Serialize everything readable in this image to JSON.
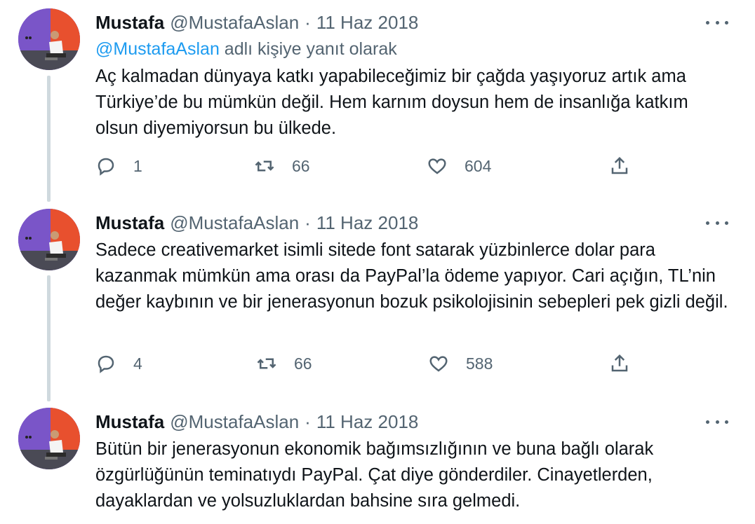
{
  "tweets": [
    {
      "name": "Mustafa",
      "handle": "@MustafaAslan",
      "separator": "·",
      "date": "11 Haz 2018",
      "reply_mention": "@MustafaAslan",
      "reply_suffix": " adlı kişiye yanıt olarak",
      "text": "Aç kalmadan dünyaya katkı yapabileceğimiz bir çağda yaşıyoruz artık ama Türkiye’de bu mümkün değil. Hem karnım doysun hem de insanlığa katkım olsun diyemiyorsun bu ülkede.",
      "replies": "1",
      "retweets": "66",
      "likes": "604"
    },
    {
      "name": "Mustafa",
      "handle": "@MustafaAslan",
      "separator": "·",
      "date": "11 Haz 2018",
      "text": "Sadece creativemarket isimli sitede font satarak yüzbinlerce dolar para kazanmak mümkün ama orası da PayPal’la ödeme yapıyor. Cari açığın, TL’nin değer kaybının ve bir jenerasyonun bozuk psikolojisinin sebepleri pek gizli değil.",
      "replies": "4",
      "retweets": "66",
      "likes": "588"
    },
    {
      "name": "Mustafa",
      "handle": "@MustafaAslan",
      "separator": "·",
      "date": "11 Haz 2018",
      "text": "Bütün bir jenerasyonun ekonomik bağımsızlığının ve buna bağlı olarak özgürlüğünün teminatıydı PayPal. Çat diye gönderdiler. Cinayetlerden, dayaklardan ve yolsuzluklardan bahsine sıra gelmedi."
    }
  ],
  "icons": {
    "reply": "reply-icon",
    "retweet": "retweet-icon",
    "like": "heart-icon",
    "share": "share-icon",
    "more": "more-options-icon"
  },
  "colors": {
    "accent": "#1d9bf0",
    "secondary_text": "#536471",
    "thread_line": "#cfd9de",
    "avatar_bg": "#7a55c8"
  }
}
